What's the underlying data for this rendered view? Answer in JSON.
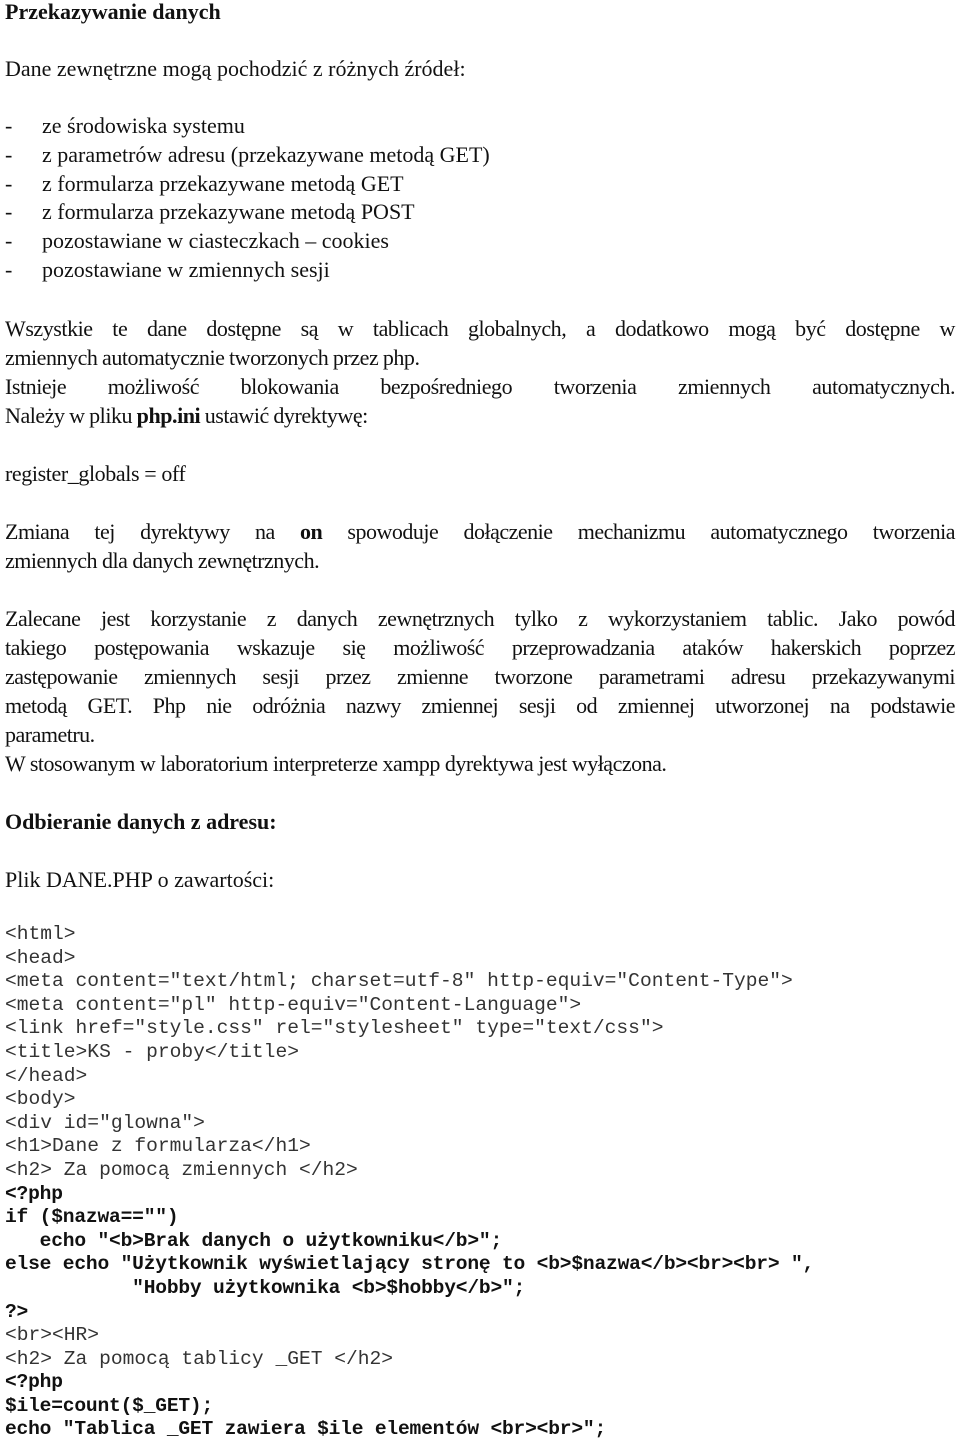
{
  "document": {
    "title": "Przekazywanie danych",
    "intro": "Dane zewnętrzne mogą pochodzić z różnych źródeł:",
    "sources_list": [
      {
        "bullet": "-",
        "text": "ze środowiska systemu"
      },
      {
        "bullet": "-",
        "text": "z parametrów adresu (przekazywane metodą GET)"
      },
      {
        "bullet": "-",
        "text": "z formularza przekazywane metodą GET"
      },
      {
        "bullet": "-",
        "text": "z formularza przekazywane metodą POST"
      },
      {
        "bullet": "-",
        "text": "pozostawiane w ciasteczkach – cookies"
      },
      {
        "bullet": "-",
        "text": "pozostawiane w zmiennych sesji"
      }
    ],
    "paragraph_globals": {
      "line1": "Wszystkie te dane dostępne są w tablicach globalnych, a dodatkowo mogą być dostępne w",
      "line2": "zmiennych automatycznie tworzonych przez php.",
      "line3": "Istnieje możliwość blokowania bezpośredniego tworzenia zmiennych automatycznych.",
      "line4_before": "Należy w pliku ",
      "line4_bold": "php.ini",
      "line4_after": " ustawić dyrektywę:"
    },
    "directive": "register_globals = off",
    "paragraph_on": {
      "line1_before": "Zmiana tej dyrektywy na ",
      "line1_bold": "on",
      "line1_after": " spowoduje dołączenie mechanizmu automatycznego tworzenia",
      "line2": "zmiennych dla danych zewnętrznych."
    },
    "paragraph_recommend": {
      "lines": [
        "Zalecane jest korzystanie z danych zewnętrznych tylko z wykorzystaniem tablic. Jako powód",
        "takiego postępowania wskazuje się możliwość przeprowadzania ataków hakerskich poprzez",
        "zastępowanie zmiennych sesji przez zmienne tworzone parametrami adresu przekazywanymi",
        "metodą GET. Php nie odróżnia nazwy zmiennej sesji od zmiennej utworzonej na podstawie",
        "parametru."
      ]
    },
    "paragraph_xampp": "W stosowanym w laboratorium interpreterze xampp dyrektywa jest wyłączona.",
    "subheading": "Odbieranie danych z adresu:",
    "file_label": "Plik DANE.PHP o zawartości:",
    "code_lines": [
      {
        "text": "<html>",
        "style": "plain"
      },
      {
        "text": "<head>",
        "style": "plain"
      },
      {
        "text": "<meta content=\"text/html; charset=utf-8\" http-equiv=\"Content-Type\">",
        "style": "plain"
      },
      {
        "text": "<meta content=\"pl\" http-equiv=\"Content-Language\">",
        "style": "plain"
      },
      {
        "text": "<link href=\"style.css\" rel=\"stylesheet\" type=\"text/css\">",
        "style": "plain"
      },
      {
        "text": "<title>KS - proby</title>",
        "style": "plain"
      },
      {
        "text": "</head>",
        "style": "plain"
      },
      {
        "text": "<body>",
        "style": "plain"
      },
      {
        "text": "<div id=\"glowna\">",
        "style": "plain"
      },
      {
        "text": "<h1>Dane z formularza</h1>",
        "style": "plain"
      },
      {
        "text": "<h2> Za pomocą zmiennych </h2>",
        "style": "plain"
      },
      {
        "text": "<?php",
        "style": "bold"
      },
      {
        "text": "if ($nazwa==\"\")",
        "style": "bold"
      },
      {
        "text": "   echo \"<b>Brak danych o użytkowniku</b>\";",
        "style": "bold"
      },
      {
        "text": "else echo \"Użytkownik wyświetlający stronę to <b>$nazwa</b><br><br> \",",
        "style": "bold"
      },
      {
        "text": "           \"Hobby użytkownika <b>$hobby</b>\";",
        "style": "bold"
      },
      {
        "text": "?>",
        "style": "bold"
      },
      {
        "text": "<br><HR>",
        "style": "plain"
      },
      {
        "text": "<h2> Za pomocą tablicy _GET </h2>",
        "style": "plain"
      },
      {
        "text": "<?php",
        "style": "bold"
      },
      {
        "text": "$ile=count($_GET);",
        "style": "bold"
      },
      {
        "text": "echo \"Tablica _GET zawiera $ile elementów <br><br>\";",
        "style": "bold"
      }
    ]
  }
}
